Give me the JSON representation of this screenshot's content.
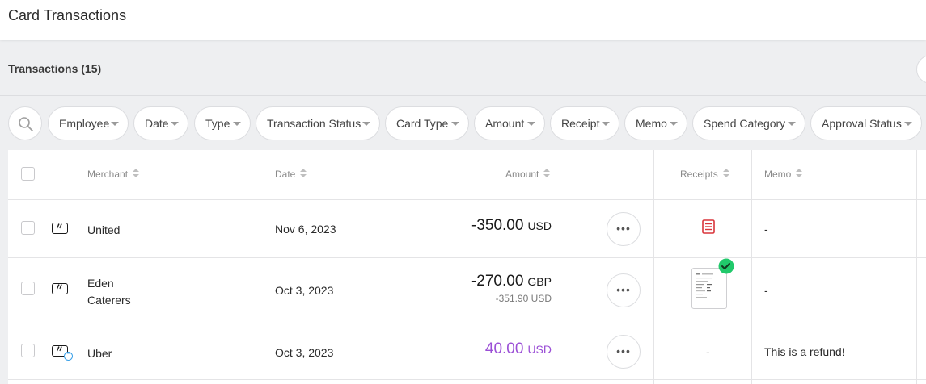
{
  "header": {
    "title": "Card Transactions"
  },
  "subheader": {
    "count_label": "Transactions (15)"
  },
  "filters": [
    "Employee",
    "Date",
    "Type",
    "Transaction Status",
    "Card Type",
    "Amount",
    "Receipt",
    "Memo",
    "Spend Category",
    "Approval Status"
  ],
  "table": {
    "columns": {
      "merchant": "Merchant",
      "date": "Date",
      "amount": "Amount",
      "receipts": "Receipts",
      "memo": "Memo"
    },
    "rows": [
      {
        "merchant": "United",
        "date": "Nov 6, 2023",
        "amount": "-350.00",
        "currency": "USD",
        "receipt": "missing-receipt-icon",
        "memo": "-"
      },
      {
        "merchant_line1": "Eden",
        "merchant_line2": "Caterers",
        "date": "Oct 3, 2023",
        "amount": "-270.00",
        "currency": "GBP",
        "converted": "-351.90 USD",
        "receipt": "receipt-thumbnail-verified",
        "memo": "-"
      },
      {
        "merchant": "Uber",
        "date": "Oct 3, 2023",
        "amount": "40.00",
        "currency": "USD",
        "receipt_text": "-",
        "memo": "This is a refund!",
        "amount_color": "#9b4fd6"
      }
    ],
    "more_label": "•••"
  },
  "colors": {
    "accent_refund": "#9b4fd6",
    "receipt_missing": "#d9343a",
    "verified_green": "#21c96b"
  }
}
